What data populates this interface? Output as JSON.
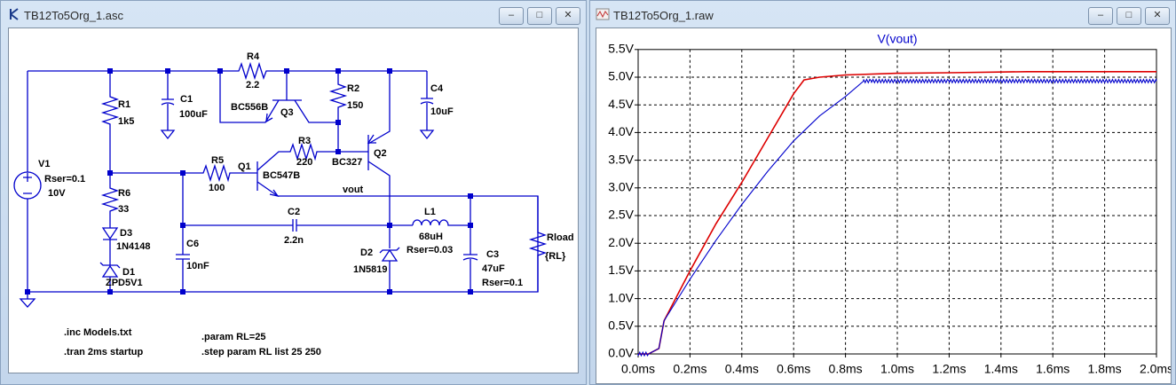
{
  "schematic_window": {
    "title": "TB12To5Org_1.asc",
    "buttons": {
      "minimize": "–",
      "maximize": "□",
      "close": "✕"
    },
    "labels": {
      "r1": "R1",
      "r1_val": "1k5",
      "c1": "C1",
      "c1_val": "100uF",
      "r4": "R4",
      "r4_val": "2.2",
      "q3_model": "BC556B",
      "q3": "Q3",
      "r2": "R2",
      "r2_val": "150",
      "c4": "C4",
      "c4_val": "10uF",
      "r3": "R3",
      "r3_val": "220",
      "q2_model": "BC327",
      "q2": "Q2",
      "q1": "Q1",
      "q1_model": "BC547B",
      "r5": "R5",
      "r5_val": "100",
      "v1": "V1",
      "v1_rser": "Rser=0.1",
      "v1_val": "10V",
      "r6": "R6",
      "r6_val": "33",
      "vout": "vout",
      "c2": "C2",
      "c2_val": "2.2n",
      "l1": "L1",
      "l1_val": "68uH",
      "l1_rser": "Rser=0.03",
      "d3": "D3",
      "d3_model": "1N4148",
      "c6": "C6",
      "c6_val": "10nF",
      "d1": "D1",
      "d1_model": "ZPD5V1",
      "d2": "D2",
      "d2_model": "1N5819",
      "c3": "C3",
      "c3_val": "47uF",
      "c3_rser": "Rser=0.1",
      "rload": "Rload",
      "rload_val": "{RL}"
    },
    "directives": {
      "inc": ".inc Models.txt",
      "tran": ".tran 2ms startup",
      "param": ".param RL=25",
      "step": ".step param RL list 25 250"
    },
    "wire_color": "#0000cc"
  },
  "waveform_window": {
    "title": "TB12To5Org_1.raw",
    "buttons": {
      "minimize": "–",
      "maximize": "□",
      "close": "✕"
    }
  },
  "chart_data": {
    "type": "line",
    "title": "V(vout)",
    "xlabel": "",
    "ylabel": "",
    "xlim": [
      0,
      2.0
    ],
    "ylim": [
      0,
      5.5
    ],
    "x_ticks": [
      "0.0ms",
      "0.2ms",
      "0.4ms",
      "0.6ms",
      "0.8ms",
      "1.0ms",
      "1.2ms",
      "1.4ms",
      "1.6ms",
      "1.8ms",
      "2.0ms"
    ],
    "y_ticks": [
      "0.0V",
      "0.5V",
      "1.0V",
      "1.5V",
      "2.0V",
      "2.5V",
      "3.0V",
      "3.5V",
      "4.0V",
      "4.5V",
      "5.0V",
      "5.5V"
    ],
    "grid": true,
    "series": [
      {
        "color": "#dd0000",
        "x": [
          0,
          0.04,
          0.06,
          0.08,
          0.1,
          0.2,
          0.3,
          0.4,
          0.5,
          0.6,
          0.64,
          0.7,
          0.8,
          1.0,
          1.2,
          1.5,
          2.0
        ],
        "y": [
          0,
          0.0,
          0.05,
          0.1,
          0.6,
          1.5,
          2.35,
          3.1,
          3.9,
          4.7,
          4.95,
          5.0,
          5.04,
          5.07,
          5.08,
          5.1,
          5.1
        ]
      },
      {
        "color": "#0000cc",
        "x": [
          0,
          0.04,
          0.06,
          0.08,
          0.1,
          0.2,
          0.3,
          0.4,
          0.5,
          0.6,
          0.7,
          0.8,
          0.87,
          0.9,
          1.2,
          1.5,
          2.0
        ],
        "y": [
          0,
          0.0,
          0.05,
          0.1,
          0.6,
          1.35,
          2.05,
          2.7,
          3.3,
          3.85,
          4.3,
          4.65,
          4.93,
          4.93,
          4.93,
          4.93,
          4.93
        ],
        "ripple": 0.03
      }
    ]
  }
}
